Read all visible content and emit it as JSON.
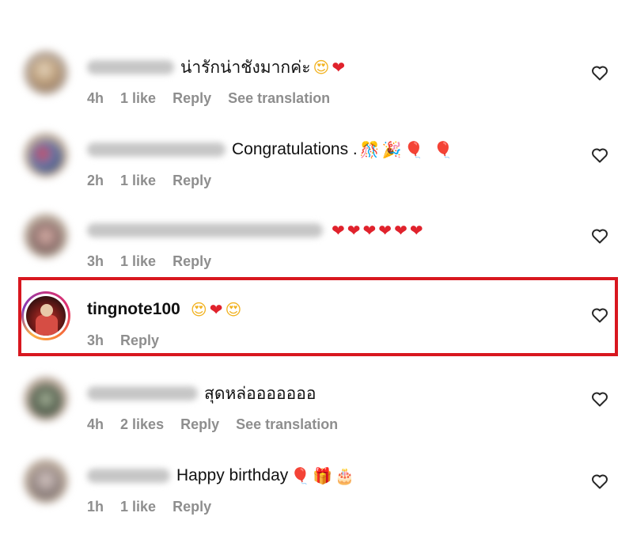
{
  "comments": [
    {
      "text": "น่ารักน่าชังมากค่ะ",
      "emojis": [
        "😍",
        "❤"
      ],
      "time": "4h",
      "likes": "1 like",
      "reply": "Reply",
      "translation": "See translation"
    },
    {
      "text": "Congratulations .",
      "emojis": [
        "🎊",
        "🎉",
        "🎈",
        "🎈"
      ],
      "time": "2h",
      "likes": "1 like",
      "reply": "Reply"
    },
    {
      "text": "",
      "emojis": [
        "❤",
        "❤",
        "❤",
        "❤",
        "❤",
        "❤"
      ],
      "time": "3h",
      "likes": "1 like",
      "reply": "Reply"
    },
    {
      "username": "tingnote100",
      "emojis": [
        "😍",
        "❤",
        "😍"
      ],
      "time": "3h",
      "reply": "Reply"
    },
    {
      "text": "สุดหล่อออออออ",
      "time": "4h",
      "likes": "2 likes",
      "reply": "Reply",
      "translation": "See translation"
    },
    {
      "text": "Happy birthday",
      "emojis": [
        "🎈",
        "🎁",
        "🎂"
      ],
      "time": "1h",
      "likes": "1 like",
      "reply": "Reply"
    }
  ],
  "icons": {
    "like": "heart-outline-icon"
  },
  "colors": {
    "highlight_border": "#d8171f",
    "meta_text": "#8e8e8e",
    "heart": "#e0222c"
  }
}
